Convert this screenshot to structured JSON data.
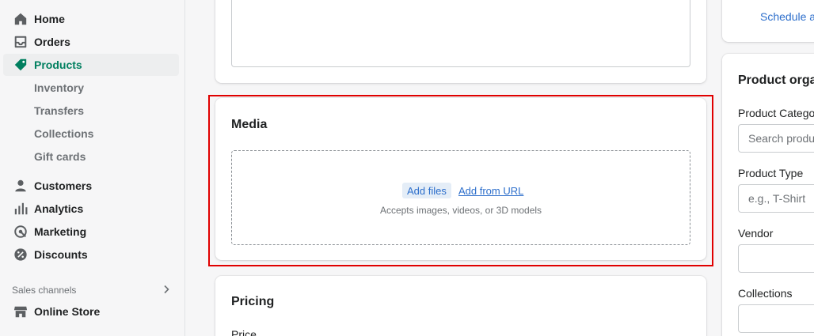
{
  "nav": {
    "home": "Home",
    "orders": "Orders",
    "products": "Products",
    "inventory": "Inventory",
    "transfers": "Transfers",
    "collections": "Collections",
    "gift_cards": "Gift cards",
    "customers": "Customers",
    "analytics": "Analytics",
    "marketing": "Marketing",
    "discounts": "Discounts",
    "sales_channels": "Sales channels",
    "online_store": "Online Store"
  },
  "media": {
    "title": "Media",
    "add_files": "Add files",
    "add_from_url": "Add from URL",
    "accepts": "Accepts images, videos, or 3D models"
  },
  "pricing": {
    "title": "Pricing",
    "price_label": "Price"
  },
  "side": {
    "schedule_link": "Schedule av",
    "organization_title": "Product organ",
    "category_label": "Product Catego",
    "category_placeholder": "Search produ",
    "type_label": "Product Type",
    "type_placeholder": "e.g., T-Shirt",
    "vendor_label": "Vendor",
    "collections_label": "Collections"
  },
  "colors": {
    "accent_green": "#007f5f",
    "link_blue": "#2c6ecb",
    "highlight_red": "#e00000"
  }
}
